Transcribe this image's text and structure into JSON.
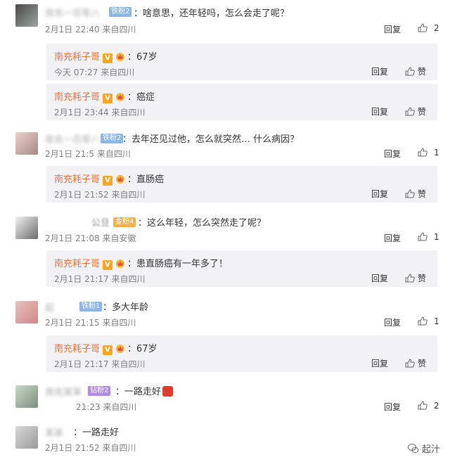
{
  "comments": [
    {
      "user": "南充一百零八",
      "level_badge": "铁粉2",
      "text": "啥意思，还年轻吗，怎么会走了呢？",
      "time": "2月1日 22:40",
      "source": "来自四川",
      "reply_label": "回复",
      "likes": "2",
      "replies": [
        {
          "user": "南充耗子哥",
          "text": "67岁",
          "time": "今天 07:27",
          "source": "来自四川",
          "reply_label": "回复",
          "likes": "赞"
        },
        {
          "user": "南充耗子哥",
          "text": "癌症",
          "time": "2月1日 23:44",
          "source": "来自四川",
          "reply_label": "回复",
          "likes": "赞"
        }
      ]
    },
    {
      "user": "南充一百零八",
      "level_badge": "铁粉2",
      "text": "去年还见过他，怎么就突然… 什么病因？",
      "time": "2月1日 21:5",
      "source": "来自四川",
      "reply_label": "回复",
      "likes": "1",
      "replies": [
        {
          "user": "南充耗子哥",
          "text": "直肠癌",
          "time": "2月1日 21:52",
          "source": "来自四川",
          "reply_label": "回复",
          "likes": "赞"
        }
      ]
    },
    {
      "user": "公旦",
      "level_badge": "金粉4",
      "text": "这么年轻，怎么突然走了呢？",
      "time": "2月1日 21:08",
      "source": "来自安徽",
      "reply_label": "回复",
      "likes": "1",
      "replies": [
        {
          "user": "南充耗子哥",
          "text": "患直肠癌有一年多了！",
          "time": "2月1日 21:17",
          "source": "来自四川",
          "reply_label": "回复",
          "likes": "赞"
        }
      ]
    },
    {
      "user": "起",
      "level_badge": "铁粉1",
      "text": "多大年龄",
      "time": "2月1日 21:15",
      "source": "来自四川",
      "reply_label": "回复",
      "likes": "1",
      "replies": [
        {
          "user": "南充耗子哥",
          "text": "67岁",
          "time": "2月1日 21:17",
          "source": "来自四川",
          "reply_label": "回复",
          "likes": "赞"
        }
      ]
    },
    {
      "user": "南充某某",
      "level_badge": "钻粉2",
      "text": "一路走好",
      "time": "21:23",
      "source": "来自四川",
      "reply_label": "回复",
      "likes": "2",
      "replies": []
    },
    {
      "user": "某某",
      "level_badge": "",
      "text": "一路走好",
      "time": "2月1日 21:52",
      "source": "来自四川",
      "reply_label": "",
      "likes": "",
      "replies": []
    }
  ],
  "watermark": "起汁",
  "colors": {
    "reply_name": "#eb7340",
    "reply_bg": "#f2f2f5",
    "meta": "#808080"
  },
  "icons": {
    "like": "thumbs-up-icon",
    "vip": "v-badge-icon",
    "crown": "crown-badge-icon",
    "gift": "gift-icon",
    "wechat": "wechat-icon"
  }
}
